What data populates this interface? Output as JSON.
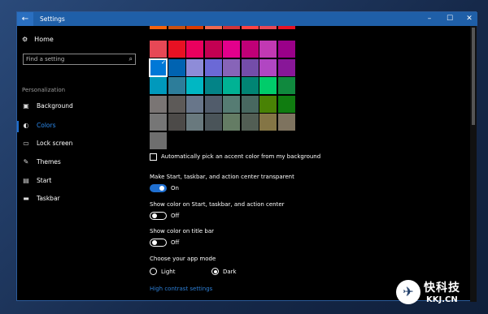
{
  "window": {
    "title": "Settings",
    "back_icon": "←",
    "minimize": "–",
    "maximize": "☐",
    "close": "✕"
  },
  "sidebar": {
    "home_label": "Home",
    "search_placeholder": "Find a setting",
    "section_label": "Personalization",
    "items": [
      {
        "label": "Background",
        "icon": "▣"
      },
      {
        "label": "Colors",
        "icon": "◐"
      },
      {
        "label": "Lock screen",
        "icon": "▭"
      },
      {
        "label": "Themes",
        "icon": "✎"
      },
      {
        "label": "Start",
        "icon": "▤"
      },
      {
        "label": "Taskbar",
        "icon": "▬"
      }
    ]
  },
  "content": {
    "swatch_rows": [
      [
        "#e74856",
        "#e81123",
        "#ea005e",
        "#c30052",
        "#e3008c",
        "#bf0077",
        "#c239b3",
        "#9a0089"
      ],
      [
        "#0078d7",
        "#0063b1",
        "#8e8cd8",
        "#6b69d6",
        "#8764b8",
        "#744da9",
        "#b146c2",
        "#881798"
      ],
      [
        "#0099bc",
        "#2d7d9a",
        "#00b7c3",
        "#038387",
        "#00b294",
        "#018574",
        "#00cc6a",
        "#10893e"
      ],
      [
        "#7a7574",
        "#5d5a58",
        "#68768a",
        "#515c6b",
        "#567c73",
        "#486860",
        "#498205",
        "#107c10"
      ],
      [
        "#767676",
        "#4c4a48",
        "#69797e",
        "#4a5459",
        "#647c64",
        "#525e54",
        "#847545",
        "#7e735f"
      ],
      [
        "#6e6e6e"
      ]
    ],
    "selected_swatch_check": "✓",
    "auto_pick_label": "Automatically pick an accent color from my background",
    "transparent_label": "Make Start, taskbar, and action center transparent",
    "transparent_state": "On",
    "show_color_start_label": "Show color on Start, taskbar, and action center",
    "show_color_start_state": "Off",
    "show_color_title_label": "Show color on title bar",
    "show_color_title_state": "Off",
    "app_mode_label": "Choose your app mode",
    "app_mode_options": [
      "Light",
      "Dark"
    ],
    "app_mode_selected": "Dark",
    "high_contrast_link": "High contrast settings"
  },
  "watermark": {
    "cn": "快科技",
    "en": "KKJ.CN"
  }
}
